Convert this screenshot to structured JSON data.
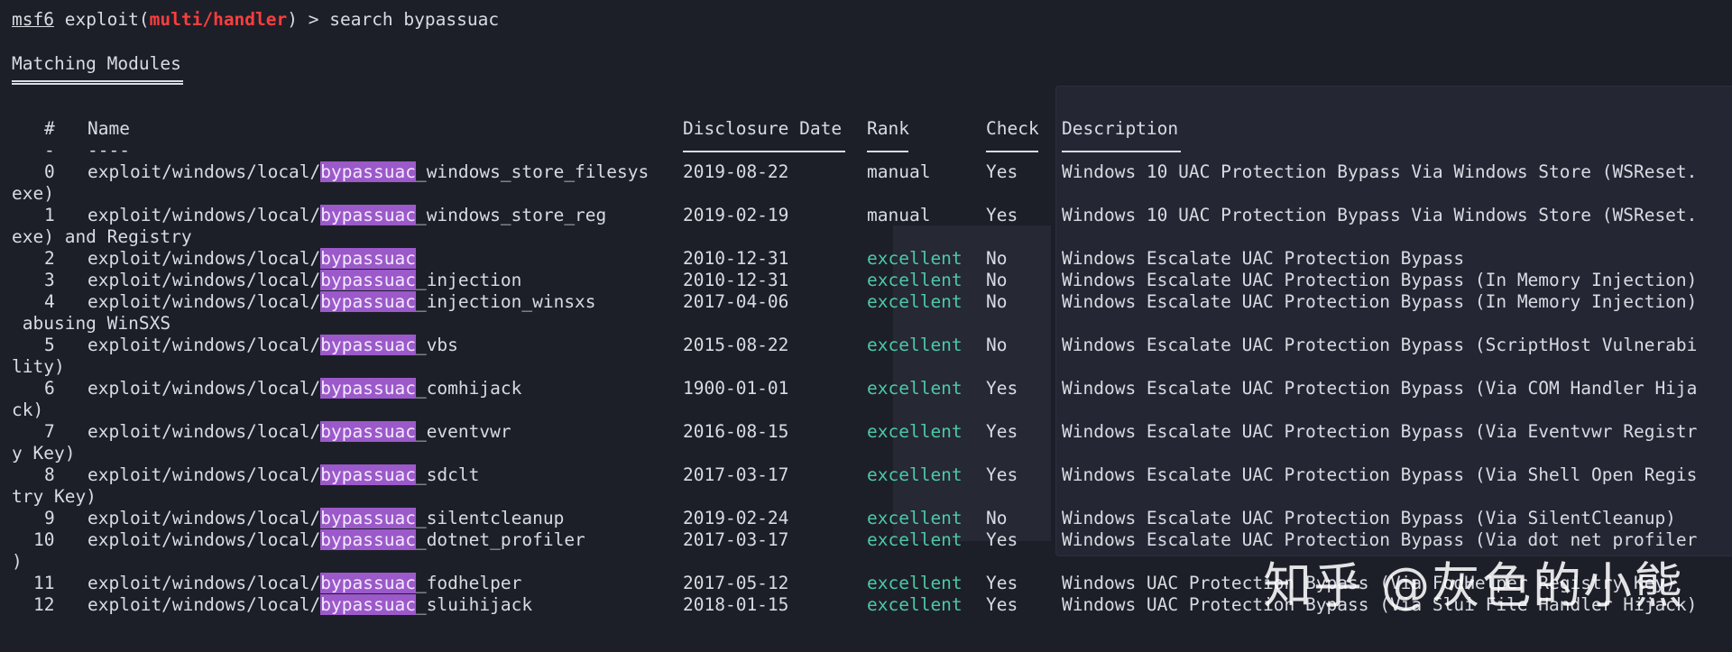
{
  "prompt": {
    "app": "msf6",
    "before_module": " exploit(",
    "module": "multi/handler",
    "after_module": ") > ",
    "command": "search bypassuac"
  },
  "section_title": "Matching Modules",
  "headers": {
    "num": "#",
    "name": "Name",
    "date": "Disclosure Date",
    "rank": "Rank",
    "check": "Check",
    "description": "Description",
    "num_underline": "-",
    "name_underline": "----"
  },
  "rows": [
    {
      "num": "0",
      "prefix": "exploit/windows/local/",
      "hl": "bypassuac",
      "suffix": "_windows_store_filesys",
      "date": "2019-08-22",
      "rank": "manual",
      "check": "Yes",
      "desc": "Windows 10 UAC Protection Bypass Via Windows Store (WSReset.",
      "wrap": "exe)"
    },
    {
      "num": "1",
      "prefix": "exploit/windows/local/",
      "hl": "bypassuac",
      "suffix": "_windows_store_reg",
      "date": "2019-02-19",
      "rank": "manual",
      "check": "Yes",
      "desc": "Windows 10 UAC Protection Bypass Via Windows Store (WSReset.",
      "wrap": "exe) and Registry"
    },
    {
      "num": "2",
      "prefix": "exploit/windows/local/",
      "hl": "bypassuac",
      "suffix": "",
      "date": "2010-12-31",
      "rank": "excellent",
      "check": "No",
      "desc": "Windows Escalate UAC Protection Bypass",
      "wrap": ""
    },
    {
      "num": "3",
      "prefix": "exploit/windows/local/",
      "hl": "bypassuac",
      "suffix": "_injection",
      "date": "2010-12-31",
      "rank": "excellent",
      "check": "No",
      "desc": "Windows Escalate UAC Protection Bypass (In Memory Injection)",
      "wrap": ""
    },
    {
      "num": "4",
      "prefix": "exploit/windows/local/",
      "hl": "bypassuac",
      "suffix": "_injection_winsxs",
      "date": "2017-04-06",
      "rank": "excellent",
      "check": "No",
      "desc": "Windows Escalate UAC Protection Bypass (In Memory Injection)",
      "wrap": " abusing WinSXS"
    },
    {
      "num": "5",
      "prefix": "exploit/windows/local/",
      "hl": "bypassuac",
      "suffix": "_vbs",
      "date": "2015-08-22",
      "rank": "excellent",
      "check": "No",
      "desc": "Windows Escalate UAC Protection Bypass (ScriptHost Vulnerabi",
      "wrap": "lity)"
    },
    {
      "num": "6",
      "prefix": "exploit/windows/local/",
      "hl": "bypassuac",
      "suffix": "_comhijack",
      "date": "1900-01-01",
      "rank": "excellent",
      "check": "Yes",
      "desc": "Windows Escalate UAC Protection Bypass (Via COM Handler Hija",
      "wrap": "ck)"
    },
    {
      "num": "7",
      "prefix": "exploit/windows/local/",
      "hl": "bypassuac",
      "suffix": "_eventvwr",
      "date": "2016-08-15",
      "rank": "excellent",
      "check": "Yes",
      "desc": "Windows Escalate UAC Protection Bypass (Via Eventvwr Registr",
      "wrap": "y Key)"
    },
    {
      "num": "8",
      "prefix": "exploit/windows/local/",
      "hl": "bypassuac",
      "suffix": "_sdclt",
      "date": "2017-03-17",
      "rank": "excellent",
      "check": "Yes",
      "desc": "Windows Escalate UAC Protection Bypass (Via Shell Open Regis",
      "wrap": "try Key)"
    },
    {
      "num": "9",
      "prefix": "exploit/windows/local/",
      "hl": "bypassuac",
      "suffix": "_silentcleanup",
      "date": "2019-02-24",
      "rank": "excellent",
      "check": "No",
      "desc": "Windows Escalate UAC Protection Bypass (Via SilentCleanup)",
      "wrap": ""
    },
    {
      "num": "10",
      "prefix": "exploit/windows/local/",
      "hl": "bypassuac",
      "suffix": "_dotnet_profiler",
      "date": "2017-03-17",
      "rank": "excellent",
      "check": "Yes",
      "desc": "Windows Escalate UAC Protection Bypass (Via dot net profiler",
      "wrap": ")"
    },
    {
      "num": "11",
      "prefix": "exploit/windows/local/",
      "hl": "bypassuac",
      "suffix": "_fodhelper",
      "date": "2017-05-12",
      "rank": "excellent",
      "check": "Yes",
      "desc": "Windows UAC Protection Bypass (Via FodHelper Registry Key)",
      "wrap": ""
    },
    {
      "num": "12",
      "prefix": "exploit/windows/local/",
      "hl": "bypassuac",
      "suffix": "_sluihijack",
      "date": "2018-01-15",
      "rank": "excellent",
      "check": "Yes",
      "desc": "Windows UAC Protection Bypass (Via Slui File Handler Hijack)",
      "wrap": ""
    }
  ],
  "watermark": "知乎 @灰色的小熊",
  "colors": {
    "background": "#1d1f28",
    "text": "#d9dbe3",
    "module_red": "#ff3d3d",
    "highlight": "#9b59c9",
    "rank_excellent": "#4cc9a6"
  }
}
